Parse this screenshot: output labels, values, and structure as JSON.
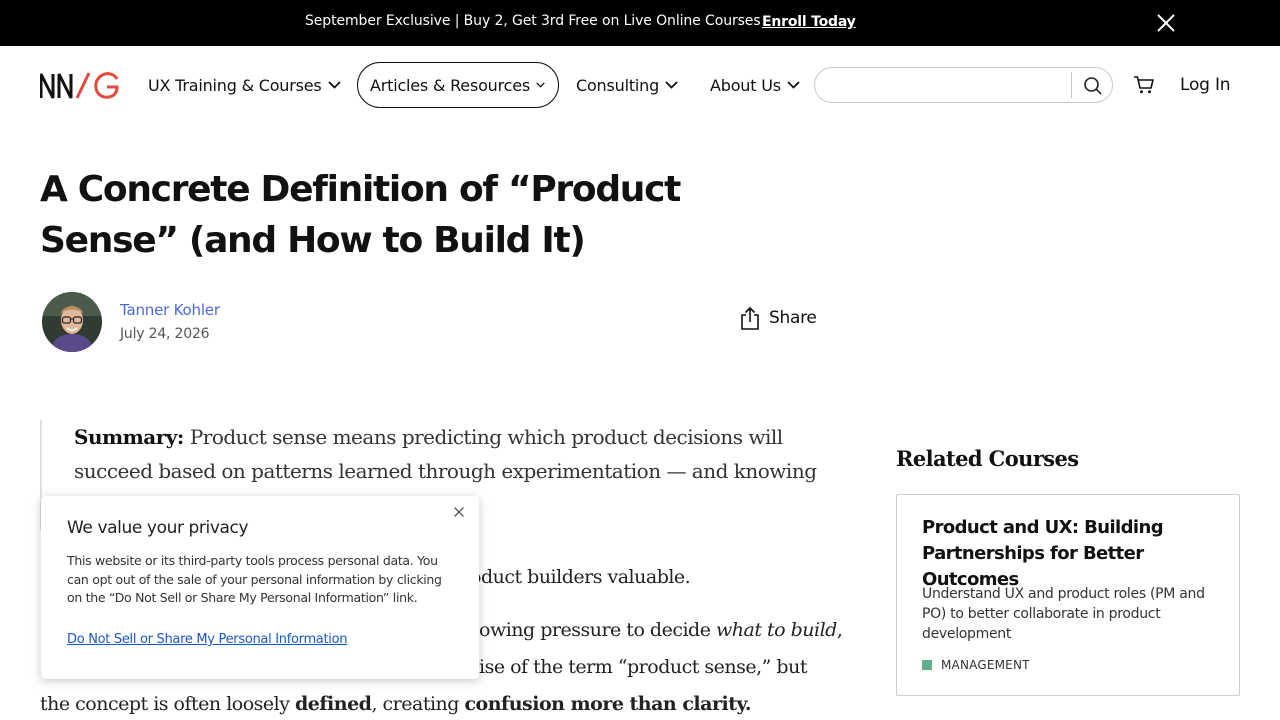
{
  "promo": {
    "text": "September Exclusive | Buy 2, Get 3rd Free on Live Online Courses",
    "link": "Enroll Today",
    "close_icon": "close-icon"
  },
  "header": {
    "logo": "NN/G",
    "nav": [
      {
        "label": "UX Training & Courses",
        "active": false
      },
      {
        "label": "Articles & Resources",
        "active": true
      },
      {
        "label": "Consulting",
        "active": false
      },
      {
        "label": "About Us",
        "active": false
      }
    ],
    "search": {
      "value": "",
      "placeholder": ""
    },
    "login": "Log In",
    "colors": {
      "accent": "#e34a3f",
      "text": "#111111"
    }
  },
  "article": {
    "title": "A Concrete Definition of “Product Sense” (and How to Build It)",
    "author": "Tanner Kohler",
    "date": "July 24, 2026",
    "share": "Share",
    "summary_label": "Summary:",
    "summary_text": "Product sense means predicting which product decisions will succeed based on patterns learned through experimentation — and knowing",
    "para1_end": "oduct builders valuable.",
    "para2_line1_a": "owing pressure to decide ",
    "para2_line1_italic": "what to build",
    "para2_line1_b": ",",
    "para2_line2": "ise of the term “product sense,” but",
    "para2_line3_a": "the concept is often loosely ",
    "para2_line3_bold1": "defined",
    "para2_line3_b": ", creating ",
    "para2_line3_bold2": "confusion more than clarity."
  },
  "sidebar": {
    "heading": "Related Courses",
    "course": {
      "title": "Product and UX: Building Partnerships for Better Outcomes",
      "description": "Understand UX and product roles (PM and PO) to better collaborate in product development",
      "tag": "MANAGEMENT",
      "tag_color": "#5fae8e"
    }
  },
  "privacy": {
    "title": "We value your privacy",
    "body": "This website or its third-party tools process personal data. You can opt out of the sale of your personal information by clicking on the “Do Not Sell or Share My Personal Information” link.",
    "link": "Do Not Sell or Share My Personal Information"
  }
}
